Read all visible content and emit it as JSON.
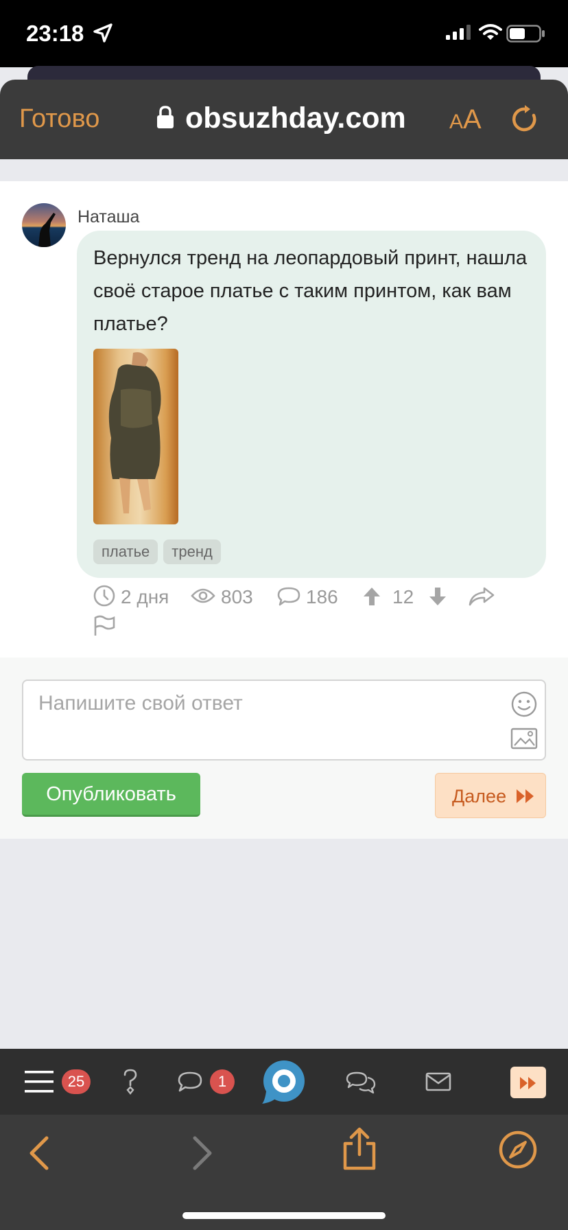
{
  "status_bar": {
    "time": "23:18"
  },
  "browser": {
    "done_label": "Готово",
    "url": "obsuzhday.com",
    "text_size_label_small": "A",
    "text_size_label_large": "A"
  },
  "post": {
    "author": "Наташа",
    "text": "Вернулся тренд на леопардовый принт, нашла своё старое платье с таким принтом, как вам платье?",
    "tags": [
      "платье",
      "тренд"
    ],
    "meta": {
      "age": "2 дня",
      "views": "803",
      "comments": "186",
      "rating": "12"
    }
  },
  "reply": {
    "placeholder": "Напишите свой ответ",
    "publish_label": "Опубликовать",
    "next_label": "Далее"
  },
  "site_nav": {
    "menu_badge": "25",
    "messages_badge": "1"
  },
  "colors": {
    "accent_orange": "#e0984a",
    "publish_green": "#5cb85c",
    "bubble_bg": "#e6f1ec",
    "badge_red": "#d9534f",
    "next_text": "#c65a1e",
    "logo_blue": "#3f93c6"
  },
  "icons": [
    "location-arrow-icon",
    "signal-icon",
    "wifi-icon",
    "battery-icon",
    "lock-icon",
    "reload-icon",
    "clock-icon",
    "eye-icon",
    "comment-icon",
    "arrow-up-icon",
    "arrow-down-icon",
    "share-icon",
    "flag-icon",
    "smile-icon",
    "image-icon",
    "fast-forward-icon",
    "menu-icon",
    "question-icon",
    "chat-icon",
    "logo-icon",
    "discussions-icon",
    "mail-icon",
    "back-icon",
    "forward-icon",
    "share-upload-icon",
    "compass-icon"
  ]
}
